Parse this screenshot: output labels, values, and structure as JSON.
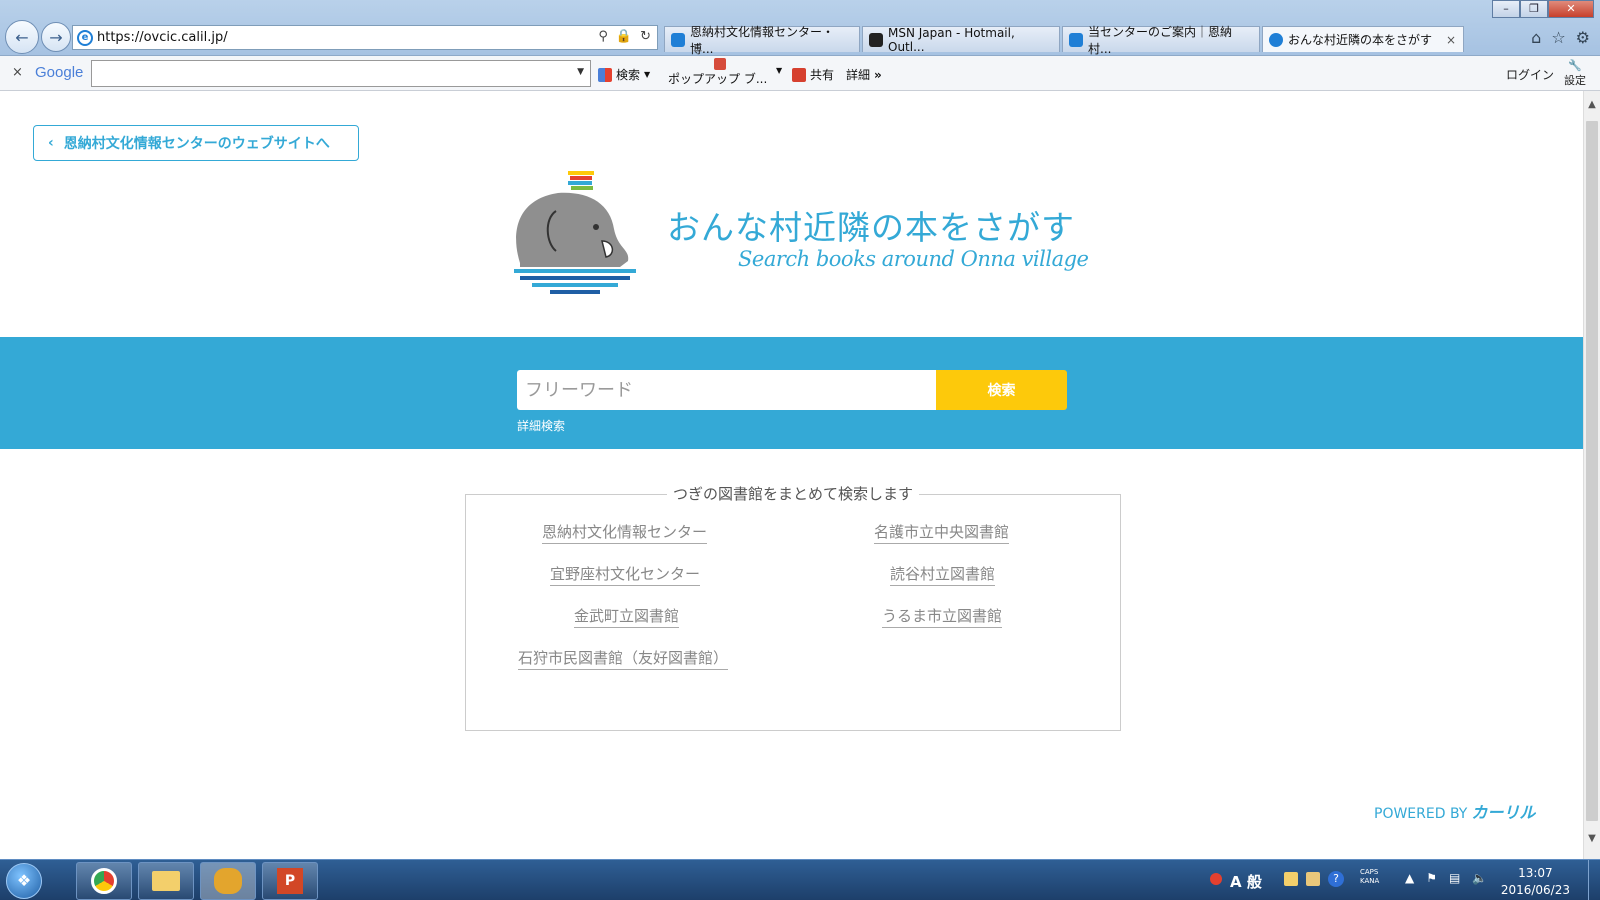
{
  "browser": {
    "url": "https://ovcic.calil.jp/",
    "tabs": [
      {
        "label": "恩納村文化情報センター・博...",
        "color": "#1f7fd6",
        "active": false
      },
      {
        "label": "MSN Japan - Hotmail, Outl...",
        "color": "#222222",
        "active": false
      },
      {
        "label": "当センターのご案内｜恩納村...",
        "color": "#1f7fd6",
        "active": false
      },
      {
        "label": "おんな村近隣の本をさがす",
        "color": "#1f7fd6",
        "active": true
      }
    ],
    "tab_close": "×"
  },
  "toolbar": {
    "close": "×",
    "google_logo": "Google",
    "search_label": "検索",
    "popup_label": "ポップアップ ブ...",
    "share_label": "共有",
    "details_label": "詳細",
    "more": "»",
    "login_label": "ログイン",
    "settings_label": "設定"
  },
  "page": {
    "back_link": "恩納村文化情報センターのウェブサイトへ",
    "title": "おんな村近隣の本をさがす",
    "subtitle": "Search books around Onna village",
    "search": {
      "placeholder": "フリーワード",
      "button": "検索",
      "advanced": "詳細検索"
    },
    "libraries_caption": "つぎの図書館をまとめて検索します",
    "libraries": [
      "恩納村文化情報センター",
      "名護市立中央図書館",
      "宜野座村文化センター",
      "読谷村立図書館",
      "金武町立図書館",
      "うるま市立図書館",
      "石狩市民図書館（友好図書館）"
    ],
    "powered_by": "POWERED BY",
    "powered_brand": "カーリル",
    "accent_color": "#34a9d6",
    "button_color": "#fdc90b"
  },
  "taskbar": {
    "ime_mode": "A 般",
    "caps": "CAPS",
    "kana": "KANA",
    "time": "13:07",
    "date": "2016/06/23"
  }
}
